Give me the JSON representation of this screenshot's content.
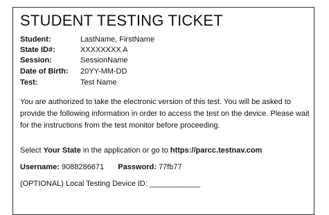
{
  "title": "STUDENT TESTING TICKET",
  "fields": [
    {
      "label": "Student:",
      "value": "LastName, FirstName"
    },
    {
      "label": "State ID#:",
      "value": "XXXXXXXX A"
    },
    {
      "label": "Session:",
      "value": "SessionName"
    },
    {
      "label": "Date of Birth:",
      "value": "20YY-MM-DD"
    },
    {
      "label": "Test:",
      "value": "Test Name"
    }
  ],
  "instructions": "You are authorized to take the electronic version of this test. You will be asked to provide the following information in order to access the test on the device. Please wait for the instructions from the test monitor before proceeding.",
  "select_state": {
    "prefix": "Select ",
    "state": "Your State",
    "middle": " in the application or go to ",
    "url": "https://parcc.testnav.com"
  },
  "credentials": {
    "username_label": "Username:",
    "username": "9088286671",
    "password_label": "Password:",
    "password": "77fb77"
  },
  "optional_device": "(OPTIONAL) Local Testing Device ID: ____________"
}
